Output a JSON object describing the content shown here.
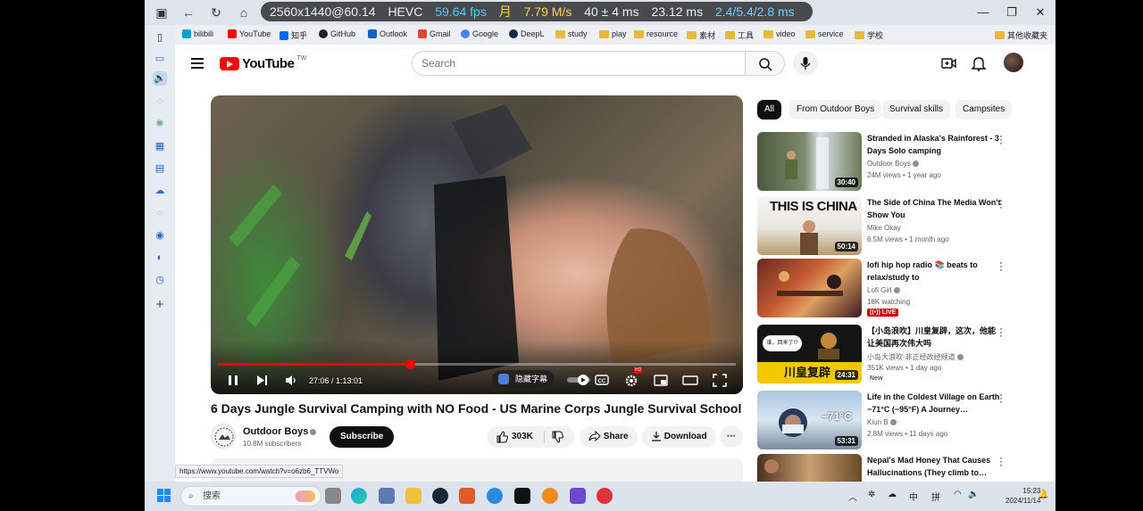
{
  "overlay": {
    "resolution": "2560x1440@60.14",
    "codec": "HEVC",
    "fps": "59.64 fps",
    "net_icon": "月",
    "net_speed": "7.79 M/s",
    "latency_a": "40 ± 4 ms",
    "latency_b": "23.12 ms",
    "cpu": "2.4/5.4/2.8 ms"
  },
  "window_controls": {
    "minimize": "—",
    "restore": "❐",
    "close": "✕"
  },
  "bookmarks": [
    "bilibili",
    "YouTube",
    "知乎",
    "GitHub",
    "Outlook",
    "Gmail",
    "Google",
    "DeepL",
    "study",
    "play",
    "resource",
    "素材",
    "工具",
    "video",
    "service",
    "学校",
    "其他收藏夹"
  ],
  "youtube": {
    "logo_text": "YouTube",
    "country_code": "TW",
    "search_placeholder": "Search"
  },
  "player": {
    "progress": 0.37,
    "time": "27:06 / 1:13:01",
    "subtitle_chip": "隐藏字幕",
    "hd_badge": "HD"
  },
  "video": {
    "title": "6 Days Jungle Survival Camping with NO Food - US Marine Corps Jungle Survival School",
    "channel": "Outdoor Boys",
    "subscribers": "10.8M subscribers",
    "subscribe_label": "Subscribe",
    "likes": "303K",
    "share_label": "Share",
    "download_label": "Download"
  },
  "status_url": "https://www.youtube.com/watch?v=o6zb6_TTVWo",
  "chips": [
    "All",
    "From Outdoor Boys",
    "Survival skills",
    "Campsites"
  ],
  "recommendations": [
    {
      "title": "Stranded in Alaska's Rainforest - 3 Days Solo camping",
      "channel": "Outdoor Boys",
      "verified": true,
      "meta": "24M views • 1 year ago",
      "duration": "30:40",
      "badge": ""
    },
    {
      "title": "The Side of China The Media Won't Show You",
      "channel": "Mike Okay",
      "verified": false,
      "meta": "6.5M views • 1 month ago",
      "duration": "50:14",
      "badge": "",
      "thumb_text": "THIS IS CHINA"
    },
    {
      "title": "lofi hip hop radio 📚 beats to relax/study to",
      "channel": "Lofi Girl",
      "verified": true,
      "meta": "18K watching",
      "duration": "",
      "badge": "LIVE"
    },
    {
      "title": "【小岛浪吹】川皇复辟，这次，他能让美国再次伟大吗",
      "channel": "小岛大浪吹-非正经政经频道",
      "verified": true,
      "meta": "351K views • 1 day ago",
      "duration": "24:31",
      "badge": "New",
      "thumb_text": "川皇复辟",
      "thumb_bubble": "谁，回来了!?"
    },
    {
      "title": "Life in the Coldest Village on Earth −71°C (−95°F) A Journey…",
      "channel": "Kiun B",
      "verified": true,
      "meta": "2.8M views • 11 days ago",
      "duration": "53:31",
      "badge": "",
      "thumb_text": "−71°C"
    },
    {
      "title": "Nepal's Mad Honey That Causes Hallucinations (They climb to…",
      "channel": "",
      "verified": false,
      "meta": "",
      "duration": "",
      "badge": ""
    }
  ],
  "taskbar": {
    "search_label": "搜索",
    "ime_a": "中",
    "ime_b": "拼",
    "time": "15:23",
    "date": "2024/11/14"
  }
}
